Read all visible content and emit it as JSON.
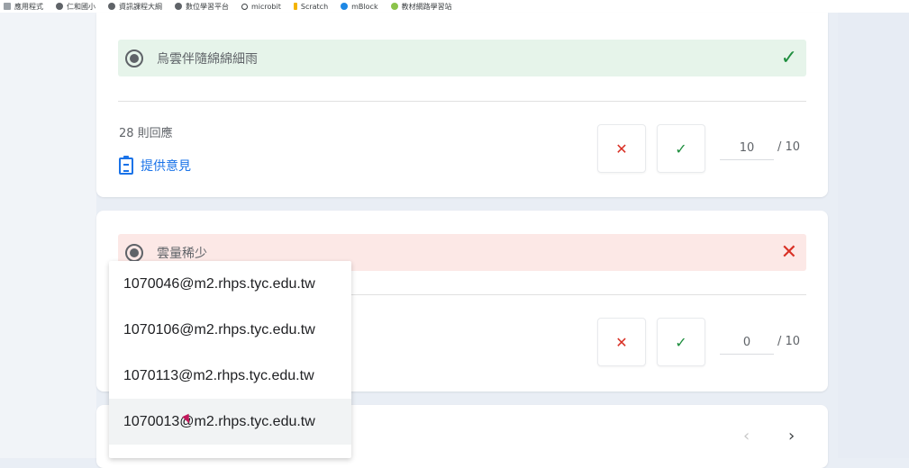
{
  "bookmarks": [
    {
      "label": "應用程式",
      "icon": "apps-icon"
    },
    {
      "label": "仁和國小",
      "icon": "globe-icon"
    },
    {
      "label": "資訊課程大綱",
      "icon": "globe-icon"
    },
    {
      "label": "數位學習平台",
      "icon": "globe-icon"
    },
    {
      "label": "microbit",
      "icon": "microbit-icon"
    },
    {
      "label": "Scratch",
      "icon": "scratch-icon"
    },
    {
      "label": "mBlock",
      "icon": "mblock-icon"
    },
    {
      "label": "教材網路學習站",
      "icon": "leaf-icon"
    }
  ],
  "question1": {
    "answer": "烏雲伴隨綿綿細雨",
    "result": "correct",
    "responses": "28 則回應",
    "feedback_label": "提供意見",
    "score": "10",
    "total": "/ 10"
  },
  "question2": {
    "answer": "雲量稀少",
    "result": "incorrect",
    "score": "0",
    "total": "/ 10"
  },
  "email_dropdown": {
    "items": [
      "1070046@m2.rhps.tyc.edu.tw",
      "1070106@m2.rhps.tyc.edu.tw",
      "1070113@m2.rhps.tyc.edu.tw",
      "1070013@m2.rhps.tyc.edu.tw"
    ],
    "hovered_index": 3
  },
  "pager": {
    "prev": "‹",
    "next": "›"
  },
  "colors": {
    "correct_bg": "#e6f4ea",
    "incorrect_bg": "#fce8e6",
    "link": "#1a73e8"
  }
}
